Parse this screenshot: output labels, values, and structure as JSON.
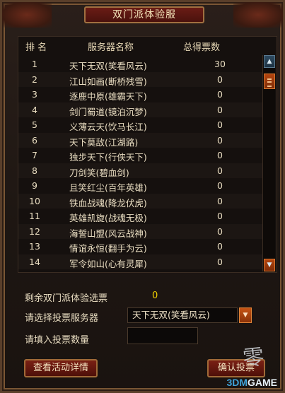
{
  "window": {
    "title": "双门派体验服"
  },
  "table": {
    "headers": {
      "rank": "排  名",
      "server": "服务器名称",
      "votes": "总得票数"
    },
    "rows": [
      {
        "rank": "1",
        "server": "天下无双(笑看风云)",
        "votes": "30"
      },
      {
        "rank": "2",
        "server": "江山如画(断桥残雪)",
        "votes": "0"
      },
      {
        "rank": "3",
        "server": "逐鹿中原(雄霸天下)",
        "votes": "0"
      },
      {
        "rank": "4",
        "server": "剑门蜀道(镜泊沉梦)",
        "votes": "0"
      },
      {
        "rank": "5",
        "server": "义薄云天(饮马长江)",
        "votes": "0"
      },
      {
        "rank": "6",
        "server": "天下莫敌(江湖路)",
        "votes": "0"
      },
      {
        "rank": "7",
        "server": "独步天下(行侠天下)",
        "votes": "0"
      },
      {
        "rank": "8",
        "server": "刀剑笑(碧血剑)",
        "votes": "0"
      },
      {
        "rank": "9",
        "server": "且笑红尘(百年英雄)",
        "votes": "0"
      },
      {
        "rank": "10",
        "server": "铁血战魂(降龙伏虎)",
        "votes": "0"
      },
      {
        "rank": "11",
        "server": "英雄凯旋(战魂无极)",
        "votes": "0"
      },
      {
        "rank": "12",
        "server": "海誓山盟(风云战神)",
        "votes": "0"
      },
      {
        "rank": "13",
        "server": "情谊永恒(翻手为云)",
        "votes": "0"
      },
      {
        "rank": "14",
        "server": "军令如山(心有灵犀)",
        "votes": "0"
      }
    ]
  },
  "form": {
    "remaining_label": "剩余双门派体验选票",
    "remaining_value": "0",
    "server_label": "请选择投票服务器",
    "server_selected": "天下无双(笑看风云)",
    "count_label": "请填入投票数量",
    "count_value": ""
  },
  "buttons": {
    "details": "查看活动详情",
    "confirm": "确认投票"
  },
  "branding": {
    "logo_glyph": "零",
    "watermark_prefix": "3DM",
    "watermark_suffix": "GAME"
  },
  "icons": {
    "scroll_up": "triangle-up-icon",
    "scroll_down": "triangle-down-icon",
    "select_arrow": "triangle-down-icon"
  },
  "colors": {
    "accent": "#c55414",
    "highlight_value": "#f0d000",
    "watermark": "#3fa2d8"
  }
}
